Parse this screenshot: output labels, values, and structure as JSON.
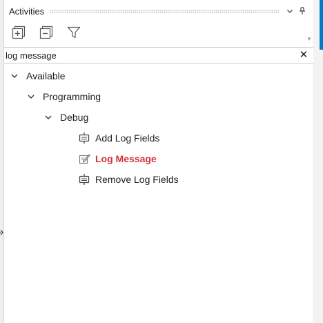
{
  "panel": {
    "title": "Activities",
    "dropdown_glyph": "⌄",
    "pin_glyph": "⊥"
  },
  "toolbar": {
    "expand_all_icon": "expand-all-icon",
    "collapse_all_icon": "collapse-all-icon",
    "filter_icon": "filter-icon"
  },
  "search": {
    "value": "log message",
    "clear_glyph": "✕"
  },
  "tree": {
    "available": {
      "label": "Available"
    },
    "programming": {
      "label": "Programming"
    },
    "debug": {
      "label": "Debug"
    },
    "items": [
      {
        "label": "Add Log Fields",
        "icon": "activity-icon",
        "selected": false
      },
      {
        "label": "Log Message",
        "icon": "log-message-icon",
        "selected": true
      },
      {
        "label": "Remove Log Fields",
        "icon": "activity-icon",
        "selected": false
      }
    ]
  },
  "side": {
    "expand_glyph": "»"
  },
  "colors": {
    "accent": "#007acc",
    "selected_text": "#d13438",
    "text": "#1e1e1e"
  }
}
